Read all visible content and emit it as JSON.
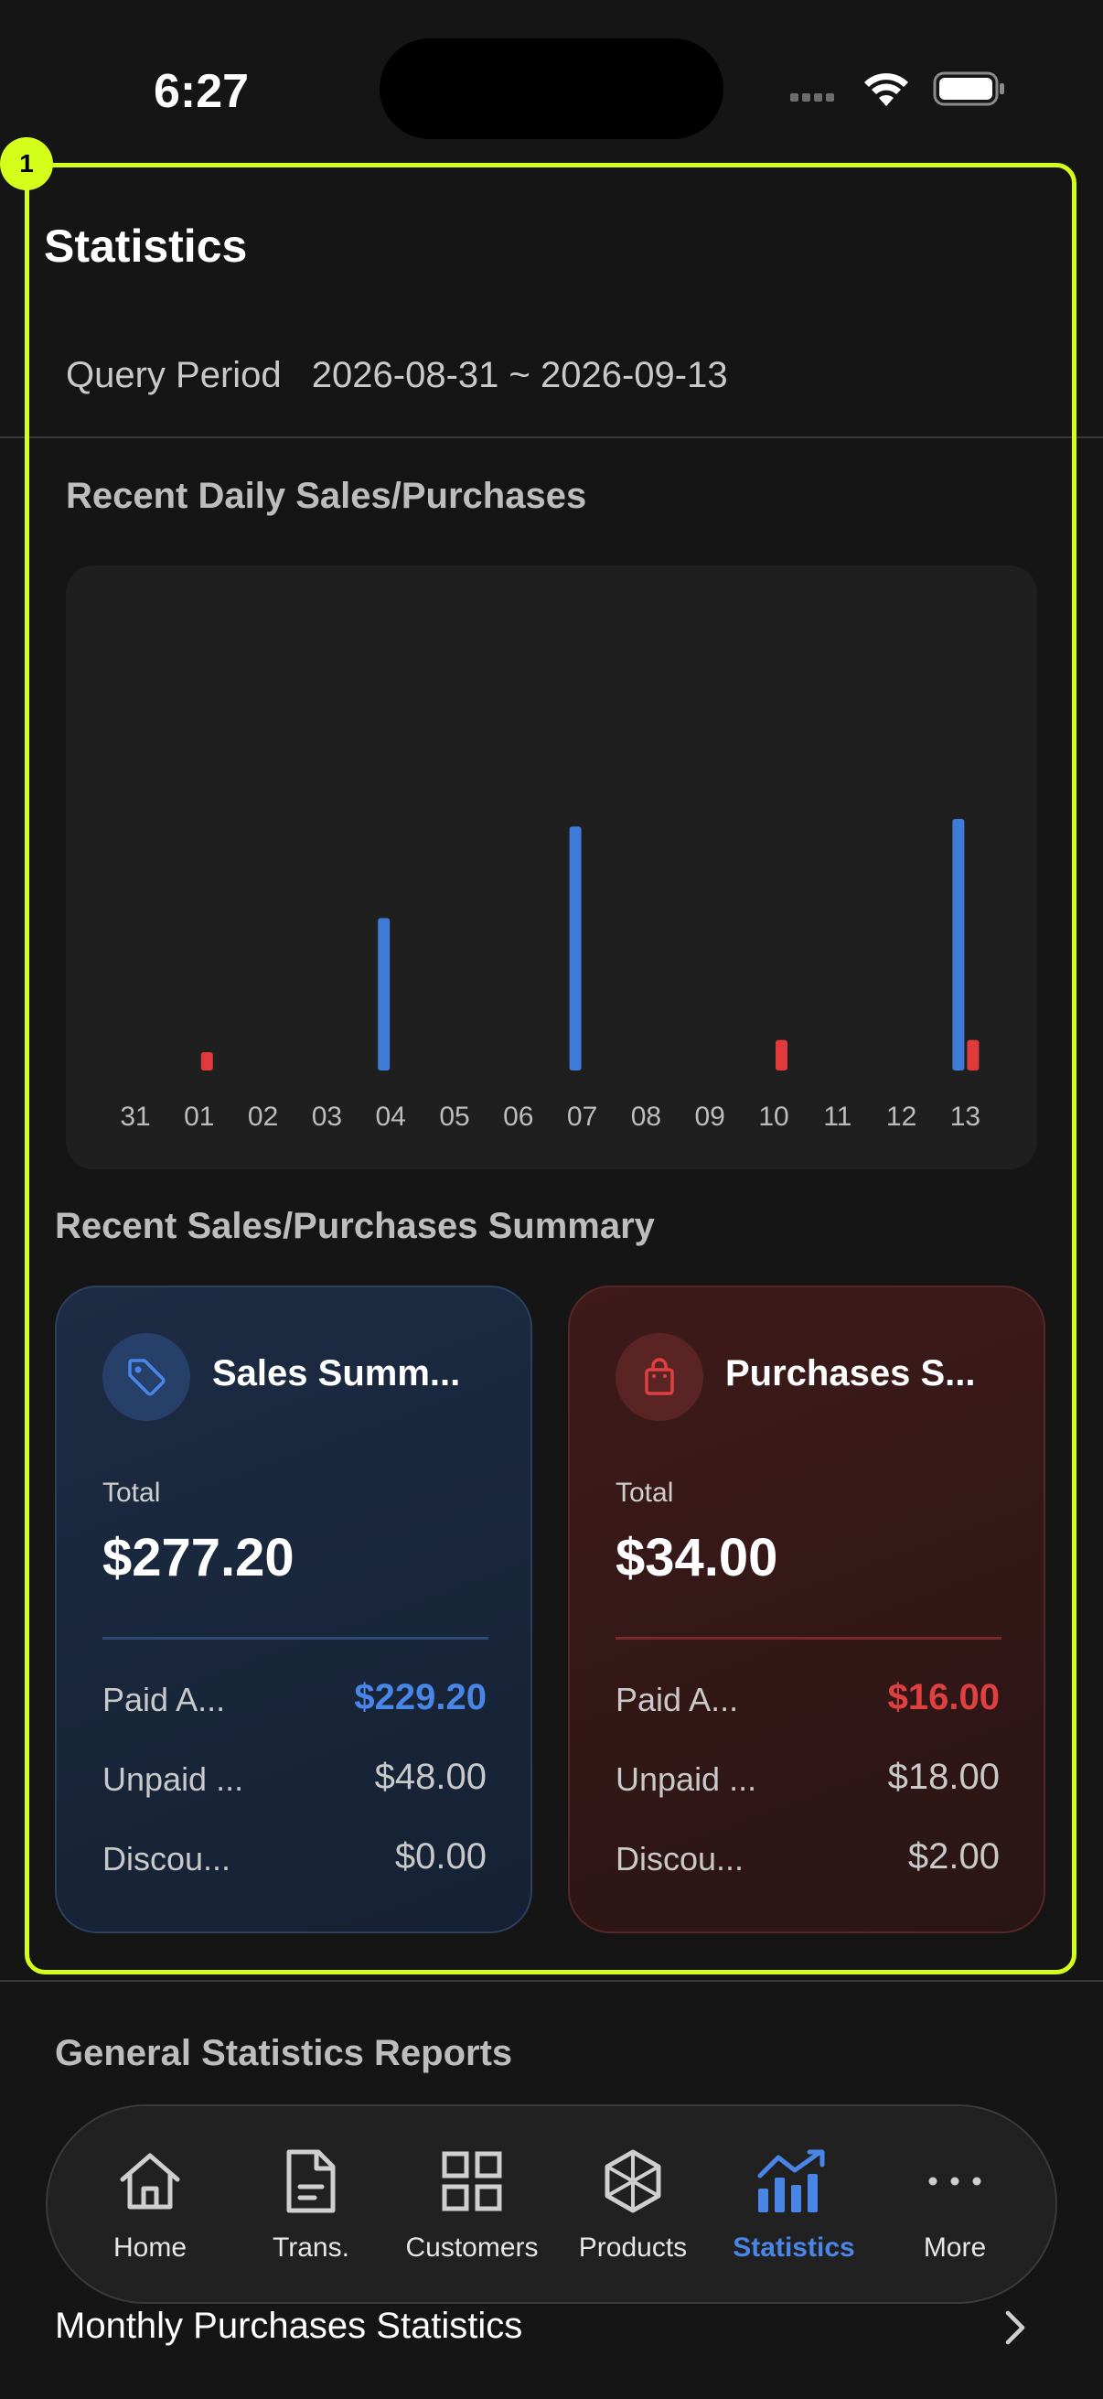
{
  "status_bar": {
    "time": "6:27"
  },
  "highlight": {
    "badge": "1"
  },
  "page": {
    "title": "Statistics"
  },
  "query": {
    "label": "Query Period",
    "value": "2026-08-31 ~ 2026-09-13"
  },
  "daily": {
    "section_title": "Recent Daily Sales/Purchases"
  },
  "chart_data": {
    "type": "bar",
    "categories": [
      "31",
      "01",
      "02",
      "03",
      "04",
      "05",
      "06",
      "07",
      "08",
      "09",
      "10",
      "11",
      "12",
      "13"
    ],
    "series": [
      {
        "color": "#3f7bd8",
        "values": [
          0,
          0,
          0,
          0,
          100,
          0,
          0,
          160,
          0,
          0,
          0,
          0,
          0,
          165
        ]
      },
      {
        "color": "#e03a3a",
        "values": [
          0,
          12,
          0,
          0,
          0,
          0,
          0,
          0,
          0,
          0,
          20,
          0,
          0,
          20
        ]
      }
    ],
    "ylim": [
      0,
      180
    ],
    "grid": false,
    "legend": "none"
  },
  "summary": {
    "section_title": "Recent Sales/Purchases Summary",
    "sales": {
      "icon": "tag-icon",
      "accent": "#4a86e8",
      "title": "Sales Summ...",
      "total_label": "Total",
      "total": "$277.20",
      "rows": [
        {
          "label": "Paid A...",
          "value": "$229.20"
        },
        {
          "label": "Unpaid ...",
          "value": "$48.00"
        },
        {
          "label": "Discou...",
          "value": "$0.00"
        }
      ]
    },
    "purchases": {
      "icon": "shopping-bag-icon",
      "accent": "#e04040",
      "title": "Purchases S...",
      "total_label": "Total",
      "total": "$34.00",
      "rows": [
        {
          "label": "Paid A...",
          "value": "$16.00"
        },
        {
          "label": "Unpaid ...",
          "value": "$18.00"
        },
        {
          "label": "Discou...",
          "value": "$2.00"
        }
      ]
    }
  },
  "reports": {
    "section_title": "General Statistics Reports",
    "items": [
      {
        "label": "Monthly Purchases Statistics"
      }
    ]
  },
  "tabbar": {
    "active_color": "#4a86e8",
    "tabs": [
      {
        "label": "Home",
        "icon": "home-icon"
      },
      {
        "label": "Trans.",
        "icon": "document-icon"
      },
      {
        "label": "Customers",
        "icon": "grid-icon"
      },
      {
        "label": "Products",
        "icon": "cube-icon"
      },
      {
        "label": "Statistics",
        "icon": "chart-icon",
        "active": true
      },
      {
        "label": "More",
        "icon": "more-icon"
      }
    ]
  }
}
